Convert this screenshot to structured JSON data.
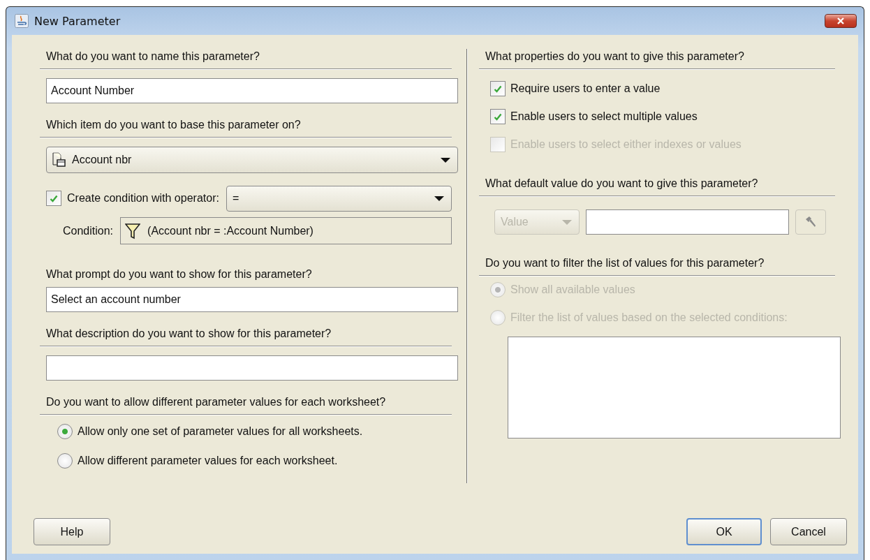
{
  "window": {
    "title": "New Parameter"
  },
  "name_section": {
    "heading": "What do you want to name this parameter?",
    "value": "Account Number"
  },
  "base_item": {
    "heading": "Which item do you want to base this parameter on?",
    "value": "Account nbr"
  },
  "condition": {
    "checked": true,
    "label": "Create condition with operator:",
    "operator": "=",
    "condition_label": "Condition:",
    "condition_text": "(Account nbr = :Account Number)"
  },
  "prompt": {
    "heading": "What prompt do you want to show for this parameter?",
    "value": "Select an account number"
  },
  "description": {
    "heading": "What description do you want to show for this parameter?"
  },
  "worksheet_values": {
    "heading": "Do you want to allow different parameter values for each worksheet?",
    "options": [
      {
        "label": "Allow only one set of parameter values for all worksheets.",
        "selected": true
      },
      {
        "label": "Allow different parameter values for each worksheet.",
        "selected": false
      }
    ]
  },
  "properties": {
    "heading": "What properties do you want to give this parameter?",
    "options": [
      {
        "label": "Require users to enter a value",
        "checked": true,
        "disabled": false
      },
      {
        "label": "Enable users to select multiple values",
        "checked": true,
        "disabled": false
      },
      {
        "label": "Enable users to select either indexes or values",
        "checked": false,
        "disabled": true
      }
    ]
  },
  "default_value": {
    "heading": "What default value do you want to give this parameter?",
    "type": "Value",
    "disabled": true
  },
  "filter": {
    "heading": "Do you want to filter the list of values for this parameter?",
    "options": [
      {
        "label": "Show all available values",
        "selected": true,
        "disabled": true
      },
      {
        "label": "Filter the list of values based on the selected conditions:",
        "selected": false,
        "disabled": true
      }
    ]
  },
  "buttons": [
    {
      "label": "Help",
      "default": false
    },
    {
      "label": "OK",
      "default": true
    },
    {
      "label": "Cancel",
      "default": false
    }
  ]
}
